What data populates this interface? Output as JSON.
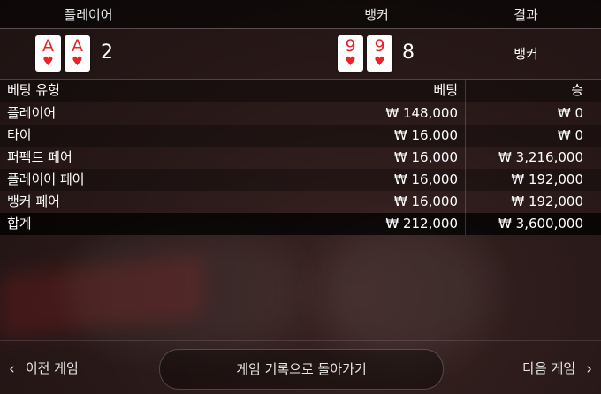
{
  "columns": {
    "player": "플레이어",
    "banker": "뱅커",
    "result": "결과"
  },
  "hands": {
    "player": {
      "cards": [
        {
          "rank": "A",
          "suit": "♥"
        },
        {
          "rank": "A",
          "suit": "♥"
        }
      ],
      "score": "2"
    },
    "banker": {
      "cards": [
        {
          "rank": "9",
          "suit": "♥"
        },
        {
          "rank": "9",
          "suit": "♥"
        }
      ],
      "score": "8"
    },
    "result": "뱅커"
  },
  "table": {
    "headers": {
      "type": "베팅 유형",
      "bet": "베팅",
      "win": "승"
    },
    "rows": [
      {
        "type": "플레이어",
        "bet": "₩ 148,000",
        "win": "₩ 0"
      },
      {
        "type": "타이",
        "bet": "₩ 16,000",
        "win": "₩ 0"
      },
      {
        "type": "퍼펙트 페어",
        "bet": "₩ 16,000",
        "win": "₩ 3,216,000"
      },
      {
        "type": "플레이어 페어",
        "bet": "₩ 16,000",
        "win": "₩ 192,000"
      },
      {
        "type": "뱅커 페어",
        "bet": "₩ 16,000",
        "win": "₩ 192,000"
      }
    ],
    "total": {
      "type": "합계",
      "bet": "₩ 212,000",
      "win": "₩ 3,600,000"
    }
  },
  "footer": {
    "prev_label": "이전 게임",
    "back_label": "게임 기록으로 돌아가기",
    "next_label": "다음 게임"
  },
  "colors": {
    "card_red": "#e8232a"
  },
  "icons": {
    "prev": "chevron-left-icon",
    "next": "chevron-right-icon"
  }
}
